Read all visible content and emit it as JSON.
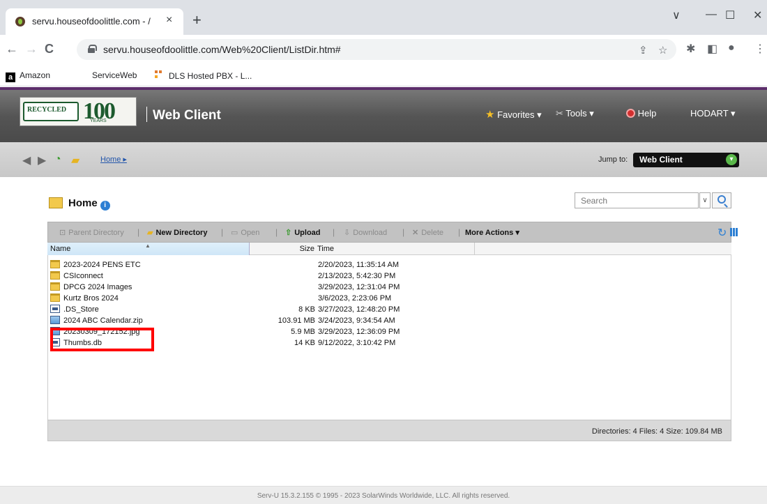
{
  "browser": {
    "tab_title": "servu.houseofdoolittle.com - /",
    "tab_close": "×",
    "new_tab": "+",
    "url": "servu.houseofdoolittle.com/Web%20Client/ListDir.htm#",
    "back": "←",
    "forward": "→",
    "reload": "C",
    "minimize": "—",
    "maximize": "☐",
    "close": "✕",
    "tab_list": "∨",
    "bookmarks": [
      {
        "label": "Amazon",
        "icon": "amazon-icon"
      },
      {
        "label": "ServiceWeb",
        "icon": "none"
      },
      {
        "label": "DLS Hosted PBX - L...",
        "icon": "dls-icon"
      }
    ]
  },
  "app": {
    "title": "Web Client",
    "logo_text": "RECYCLED",
    "logo_number": "100",
    "logo_years": "YEARS",
    "menu": {
      "favorites": "Favorites ▾",
      "tools": "Tools ▾",
      "help": "Help",
      "user": "HODART ▾"
    }
  },
  "breadcrumb": {
    "home": "Home",
    "jump_label": "Jump to:",
    "jump_value": "Web Client"
  },
  "directory": {
    "title": "Home",
    "search_placeholder": "Search"
  },
  "toolbar": {
    "parent_directory": "Parent Directory",
    "new_directory": "New Directory",
    "open": "Open",
    "upload": "Upload",
    "download": "Download",
    "delete": "Delete",
    "more_actions": "More Actions ▾"
  },
  "columns": {
    "name": "Name",
    "size": "Size",
    "time": "Time"
  },
  "files": [
    {
      "name": "2023-2024 PENS ETC",
      "size": "",
      "time": "2/20/2023, 11:35:14 AM",
      "type": "folder"
    },
    {
      "name": "CSIconnect",
      "size": "",
      "time": "2/13/2023, 5:42:30 PM",
      "type": "folder"
    },
    {
      "name": "DPCG 2024 Images",
      "size": "",
      "time": "3/29/2023, 12:31:04 PM",
      "type": "folder"
    },
    {
      "name": "Kurtz Bros 2024",
      "size": "",
      "time": "3/6/2023, 2:23:06 PM",
      "type": "folder"
    },
    {
      "name": ".DS_Store",
      "size": "8 KB",
      "time": "3/27/2023, 12:48:20 PM",
      "type": "file"
    },
    {
      "name": "2024 ABC Calendar.zip",
      "size": "103.91 MB",
      "time": "3/24/2023, 9:34:54 AM",
      "type": "img"
    },
    {
      "name": "20230309_172152.jpg",
      "size": "5.9 MB",
      "time": "3/29/2023, 12:36:09 PM",
      "type": "img"
    },
    {
      "name": "Thumbs.db",
      "size": "14 KB",
      "time": "9/12/2022, 3:10:42 PM",
      "type": "file"
    }
  ],
  "status": "Directories: 4   Files: 4   Size: 109.84 MB",
  "footer": "Serv-U 15.3.2.155 © 1995 - 2023 SolarWinds Worldwide, LLC. All rights reserved.",
  "colors": {
    "header_purple": "#5c2d6b",
    "highlight_red": "#ff0000",
    "link_blue": "#2255aa"
  }
}
